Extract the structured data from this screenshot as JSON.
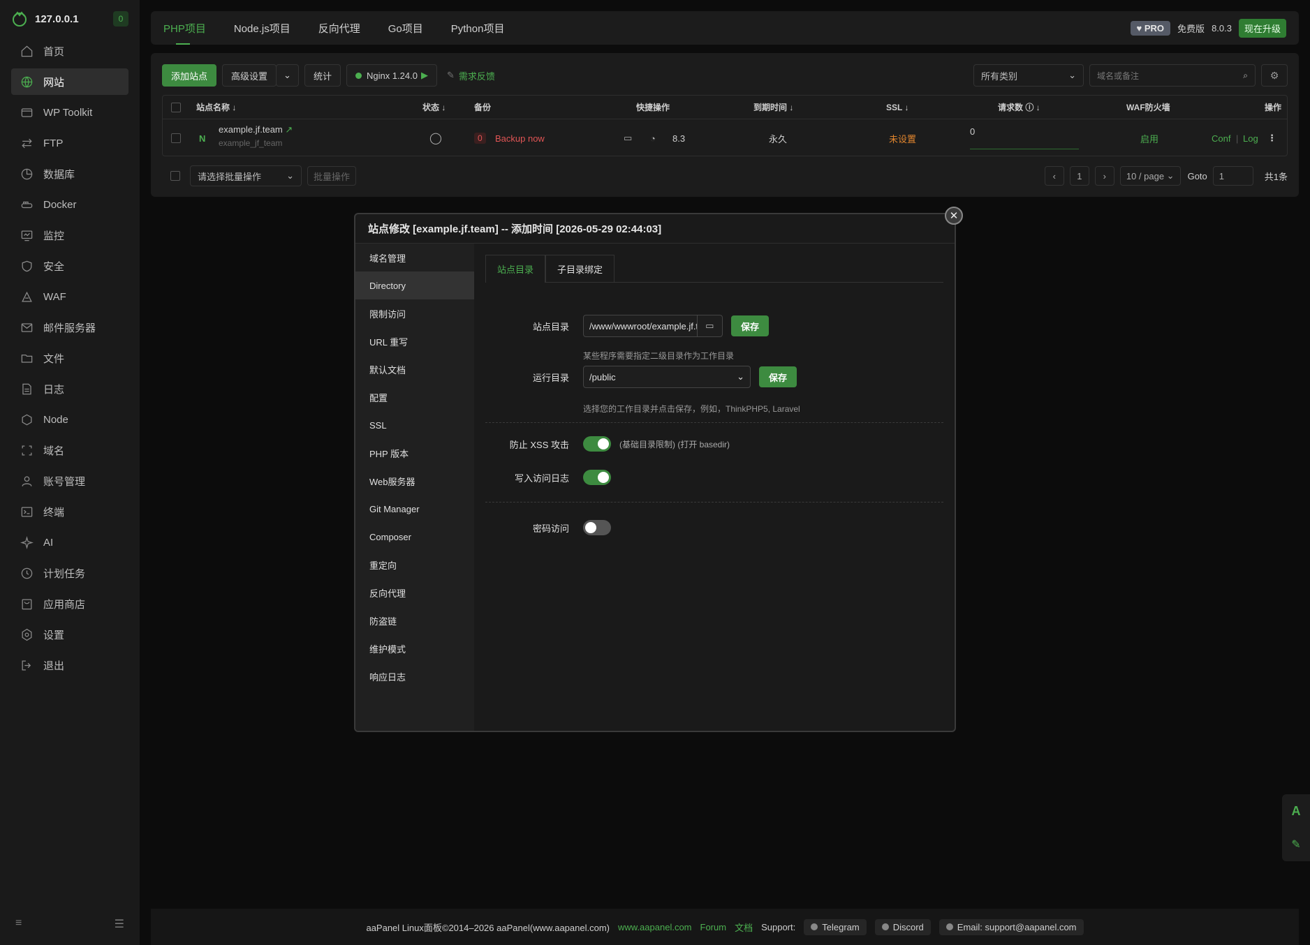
{
  "sidebar": {
    "host": "127.0.0.1",
    "badge": "0",
    "items": [
      {
        "label": "首页",
        "icon": "home-icon"
      },
      {
        "label": "网站",
        "icon": "globe-icon"
      },
      {
        "label": "WP Toolkit",
        "icon": "wp-icon"
      },
      {
        "label": "FTP",
        "icon": "ftp-icon"
      },
      {
        "label": "数据库",
        "icon": "database-icon"
      },
      {
        "label": "Docker",
        "icon": "docker-icon"
      },
      {
        "label": "监控",
        "icon": "monitor-icon"
      },
      {
        "label": "安全",
        "icon": "shield-icon"
      },
      {
        "label": "WAF",
        "icon": "waf-icon"
      },
      {
        "label": "邮件服务器",
        "icon": "mail-icon"
      },
      {
        "label": "文件",
        "icon": "folder-icon"
      },
      {
        "label": "日志",
        "icon": "log-icon"
      },
      {
        "label": "Node",
        "icon": "node-icon"
      },
      {
        "label": "域名",
        "icon": "domain-icon"
      },
      {
        "label": "账号管理",
        "icon": "user-icon"
      },
      {
        "label": "终端",
        "icon": "terminal-icon"
      },
      {
        "label": "AI",
        "icon": "ai-icon"
      },
      {
        "label": "计划任务",
        "icon": "clock-icon"
      },
      {
        "label": "应用商店",
        "icon": "store-icon"
      },
      {
        "label": "设置",
        "icon": "gear-icon"
      },
      {
        "label": "退出",
        "icon": "logout-icon"
      }
    ],
    "active_index": 1
  },
  "topbar": {
    "tabs": [
      "PHP项目",
      "Node.js项目",
      "反向代理",
      "Go项目",
      "Python项目"
    ],
    "pro": "PRO",
    "edition": "免费版",
    "version": "8.0.3",
    "upgrade": "现在升级"
  },
  "toolbar": {
    "add_site": "添加站点",
    "advanced": "高级设置",
    "stats": "统计",
    "nginx": "Nginx 1.24.0",
    "feedback": "需求反馈",
    "category": "所有类别",
    "search_placeholder": "域名或备注"
  },
  "table": {
    "headers": {
      "name": "站点名称",
      "status": "状态",
      "backup": "备份",
      "quick": "快捷操作",
      "expire": "到期时间",
      "ssl": "SSL",
      "requests": "请求数",
      "waf": "WAF防火墙",
      "ops": "操作"
    },
    "row": {
      "domain": "example.jf.team",
      "remark": "example_jf_team",
      "backup_count": "0",
      "backup_action": "Backup now",
      "php": "8.3",
      "expire": "永久",
      "ssl": "未设置",
      "requests": "0",
      "waf": "启用",
      "conf": "Conf",
      "log": "Log"
    }
  },
  "pager": {
    "batch_placeholder": "请选择批量操作",
    "batch_btn": "批量操作",
    "page": "1",
    "per_page": "10 / page",
    "goto": "Goto",
    "goto_value": "1",
    "total": "共1条"
  },
  "modal": {
    "title": "站点修改 [example.jf.team] -- 添加时间 [2026-05-29 02:44:03]",
    "nav": [
      "域名管理",
      "Directory",
      "限制访问",
      "URL 重写",
      "默认文档",
      "配置",
      "SSL",
      "PHP 版本",
      "Web服务器",
      "Git Manager",
      "Composer",
      "重定向",
      "反向代理",
      "防盗链",
      "维护模式",
      "响应日志"
    ],
    "nav_active": 1,
    "tabs": [
      "站点目录",
      "子目录绑定"
    ],
    "site_dir_label": "站点目录",
    "site_dir_value": "/www/wwwroot/example.jf.team",
    "save": "保存",
    "site_dir_hint": "某些程序需要指定二级目录作为工作目录",
    "run_dir_label": "运行目录",
    "run_dir_value": "/public",
    "run_dir_hint": "选择您的工作目录并点击保存，例如，ThinkPHP5, Laravel",
    "xss_label": "防止 XSS 攻击",
    "xss_hint": "(基础目录限制) (打开 basedir)",
    "xss_on": true,
    "access_log_label": "写入访问日志",
    "access_log_on": true,
    "password_label": "密码访问",
    "password_on": false
  },
  "footer": {
    "copyright": "aaPanel Linux面板©2014–2026 aaPanel(www.aapanel.com)",
    "site": "www.aapanel.com",
    "forum": "Forum",
    "docs": "文档",
    "support": "Support:",
    "telegram": "Telegram",
    "discord": "Discord",
    "email": "Email: support@aapanel.com"
  }
}
